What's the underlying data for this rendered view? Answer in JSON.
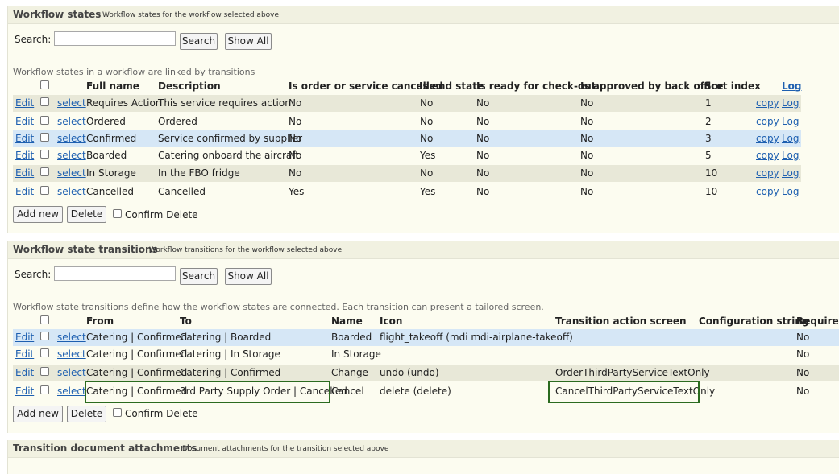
{
  "states_panel": {
    "title": "Workflow states",
    "subtitle": "Workflow states for the workflow selected above",
    "search_label": "Search:",
    "search_value": "",
    "search_button": "Search",
    "show_all_button": "Show All",
    "hint": "Workflow states in a workflow are linked by transitions",
    "columns": {
      "full_name": "Full name",
      "description": "Description",
      "cancelled": "Is order or service cancelled",
      "end_state": "Is end state",
      "ready": "Is ready for check-out",
      "approved": "Is approved by back office",
      "sort_index": "Sort index",
      "log": "Log"
    },
    "rows": [
      {
        "edit": "Edit",
        "select": "select",
        "full_name": "Requires Action",
        "description": "This service requires action",
        "cancelled": "No",
        "end_state": "No",
        "ready": "No",
        "approved": "No",
        "sort_index": "1",
        "copy": "copy",
        "log": "Log"
      },
      {
        "edit": "Edit",
        "select": "select",
        "full_name": "Ordered",
        "description": "Ordered",
        "cancelled": "No",
        "end_state": "No",
        "ready": "No",
        "approved": "No",
        "sort_index": "2",
        "copy": "copy",
        "log": "Log"
      },
      {
        "edit": "Edit",
        "select": "select",
        "full_name": "Confirmed",
        "description": "Service confirmed by supplier",
        "cancelled": "No",
        "end_state": "No",
        "ready": "No",
        "approved": "No",
        "sort_index": "3",
        "copy": "copy",
        "log": "Log"
      },
      {
        "edit": "Edit",
        "select": "select",
        "full_name": "Boarded",
        "description": "Catering onboard the aircraft",
        "cancelled": "No",
        "end_state": "Yes",
        "ready": "No",
        "approved": "No",
        "sort_index": "5",
        "copy": "copy",
        "log": "Log"
      },
      {
        "edit": "Edit",
        "select": "select",
        "full_name": "In Storage",
        "description": "In the FBO fridge",
        "cancelled": "No",
        "end_state": "No",
        "ready": "No",
        "approved": "No",
        "sort_index": "10",
        "copy": "copy",
        "log": "Log"
      },
      {
        "edit": "Edit",
        "select": "select",
        "full_name": "Cancelled",
        "description": "Cancelled",
        "cancelled": "Yes",
        "end_state": "Yes",
        "ready": "No",
        "approved": "No",
        "sort_index": "10",
        "copy": "copy",
        "log": "Log"
      }
    ],
    "add_new_button": "Add new",
    "delete_button": "Delete",
    "confirm_delete_label": "Confirm Delete"
  },
  "transitions_panel": {
    "title": "Workflow state transitions",
    "subtitle": "Workflow transitions for the workflow selected above",
    "search_label": "Search:",
    "search_value": "",
    "search_button": "Search",
    "show_all_button": "Show All",
    "hint": "Workflow state transitions define how the workflow states are connected. Each transition can present a tailored screen.",
    "columns": {
      "from": "From",
      "to": "To",
      "name": "Name",
      "icon": "Icon",
      "screen": "Transition action screen",
      "config": "Configuration string",
      "require": "Require a"
    },
    "rows": [
      {
        "edit": "Edit",
        "select": "select",
        "from": "Catering | Confirmed",
        "to": "Catering | Boarded",
        "name": "Boarded",
        "icon": "flight_takeoff (mdi mdi-airplane-takeoff)",
        "screen": "",
        "config": "",
        "require": "No"
      },
      {
        "edit": "Edit",
        "select": "select",
        "from": "Catering | Confirmed",
        "to": "Catering | In Storage",
        "name": "In Storage",
        "icon": "",
        "screen": "",
        "config": "",
        "require": "No"
      },
      {
        "edit": "Edit",
        "select": "select",
        "from": "Catering | Confirmed",
        "to": "Catering | Confirmed",
        "name": "Change",
        "icon": "undo (undo)",
        "screen": "OrderThirdPartyServiceTextOnly",
        "config": "",
        "require": "No"
      },
      {
        "edit": "Edit",
        "select": "select",
        "from": "Catering | Confirmed",
        "to": "3rd Party Supply Order | Cancelled",
        "name": "Cancel",
        "icon": "delete (delete)",
        "screen": "CancelThirdPartyServiceTextOnly",
        "config": "",
        "require": "No"
      }
    ],
    "add_new_button": "Add new",
    "delete_button": "Delete",
    "confirm_delete_label": "Confirm Delete"
  },
  "attachments_panel": {
    "title": "Transition document attachments",
    "subtitle": "Document attachments for the transition selected above"
  },
  "colors": {
    "panel_bg": "#fcfcf0",
    "header_bg": "#f1f1e1",
    "row_gray": "#e8e8d8",
    "row_blue": "#d6e7f6",
    "header_text": "#2f65b8",
    "link": "#1d5fb0",
    "highlight_border": "#2b6b1f"
  }
}
